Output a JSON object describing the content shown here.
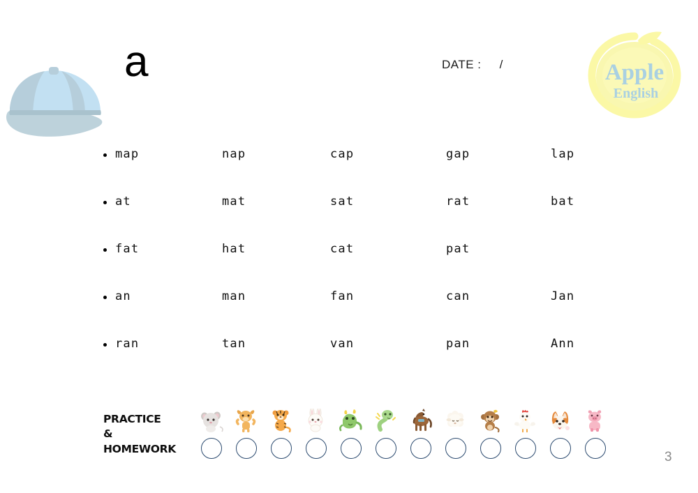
{
  "header": {
    "letter": "a",
    "date_label": "DATE :",
    "date_separator": "/",
    "cap_icon": "baseball-cap-icon"
  },
  "logo": {
    "line1": "Apple",
    "line2": "English",
    "apple_color": "#f7f5a8",
    "text_color": "#a8cfe0"
  },
  "word_rows": [
    {
      "words": [
        "map",
        "nap",
        "cap",
        "gap",
        "lap"
      ]
    },
    {
      "words": [
        "at",
        "mat",
        "sat",
        "rat",
        "bat"
      ]
    },
    {
      "words": [
        "fat",
        "hat",
        "cat",
        "pat",
        ""
      ]
    },
    {
      "words": [
        "an",
        "man",
        "fan",
        "can",
        "Jan"
      ]
    },
    {
      "words": [
        "ran",
        "tan",
        "van",
        "pan",
        "Ann"
      ]
    }
  ],
  "practice": {
    "label_line1": "PRACTICE",
    "label_line2": "&",
    "label_line3": "HOMEWORK",
    "circle_color": "#2b4a6f",
    "stickers": [
      {
        "name": "rat-sticker"
      },
      {
        "name": "ox-sticker"
      },
      {
        "name": "tiger-sticker"
      },
      {
        "name": "rabbit-sticker"
      },
      {
        "name": "dragon-sticker"
      },
      {
        "name": "snake-sticker"
      },
      {
        "name": "horse-sticker"
      },
      {
        "name": "goat-sticker"
      },
      {
        "name": "monkey-sticker"
      },
      {
        "name": "rooster-sticker"
      },
      {
        "name": "dog-sticker"
      },
      {
        "name": "pig-sticker"
      }
    ]
  },
  "footer": {
    "page_number": "3"
  }
}
